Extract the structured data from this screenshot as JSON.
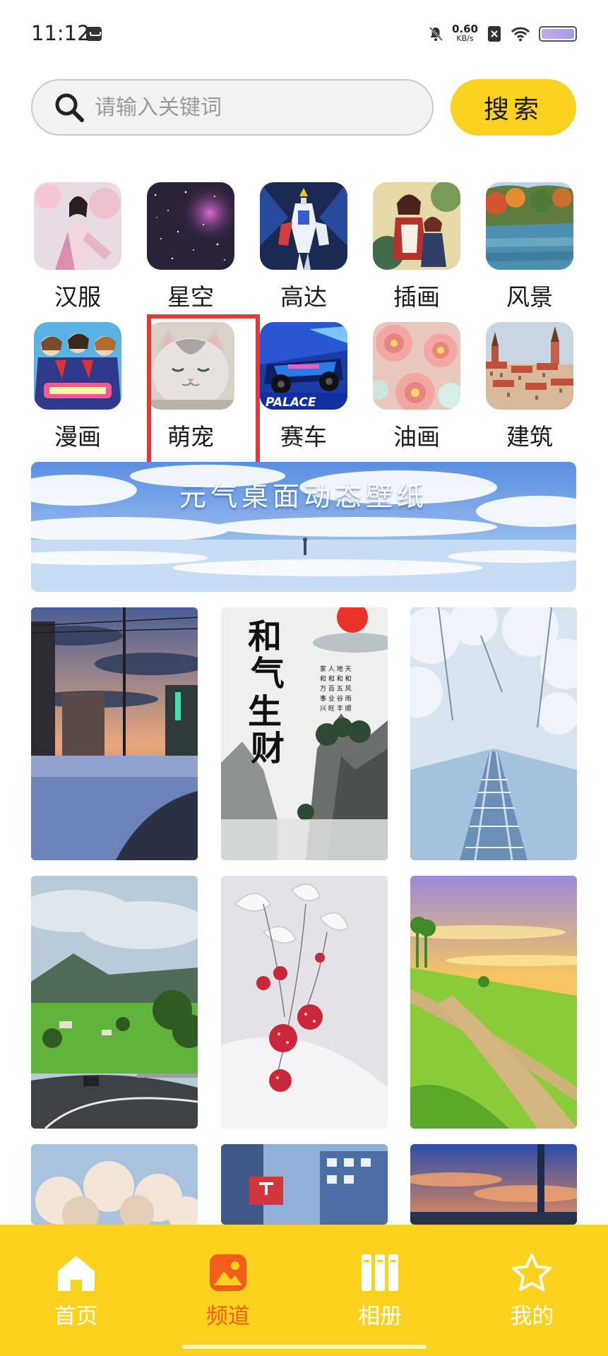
{
  "status_bar": {
    "time": "11:12",
    "net_speed_value": "0.60",
    "net_speed_unit": "KB/s"
  },
  "search": {
    "placeholder": "请输入关键词",
    "button_label": "搜索"
  },
  "categories": [
    {
      "label": "汉服"
    },
    {
      "label": "星空"
    },
    {
      "label": "高达"
    },
    {
      "label": "插画"
    },
    {
      "label": "风景"
    },
    {
      "label": "漫画"
    },
    {
      "label": "萌宠"
    },
    {
      "label": "赛车"
    },
    {
      "label": "油画"
    },
    {
      "label": "建筑"
    }
  ],
  "highlighted_category": "萌宠",
  "banner": {
    "title": "元气桌面动态壁纸"
  },
  "wallpapers": {
    "racing_badge": "PALACE",
    "calligraphy_1": "和",
    "calligraphy_2": "气",
    "calligraphy_3": "生",
    "calligraphy_4": "财"
  },
  "bottom_nav": [
    {
      "label": "首页",
      "icon": "home-icon",
      "active": false
    },
    {
      "label": "频道",
      "icon": "image-icon",
      "active": true
    },
    {
      "label": "相册",
      "icon": "album-icon",
      "active": false
    },
    {
      "label": "我的",
      "icon": "star-icon",
      "active": false
    }
  ],
  "colors": {
    "accent": "#fcd220",
    "active_nav": "#f25d1a",
    "highlight_box": "#e23a3a"
  }
}
